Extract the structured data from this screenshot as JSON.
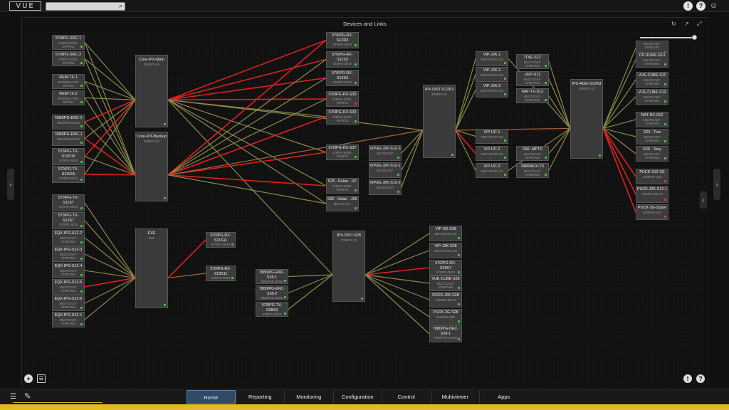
{
  "app": {
    "logo": "VUE"
  },
  "canvas": {
    "title": "Devices and Links"
  },
  "nav": {
    "tabs": [
      {
        "label": "Home",
        "active": true
      },
      {
        "label": "Reporting"
      },
      {
        "label": "Monitoring"
      },
      {
        "label": "Configuration"
      },
      {
        "label": "Control"
      },
      {
        "label": "Multiviewer"
      },
      {
        "label": "Apps"
      }
    ]
  },
  "icons": {
    "search": "search-icon",
    "alert": "!",
    "help": "?",
    "user": "user-icon",
    "refresh": "refresh-icon",
    "popout": "popout-icon",
    "collapse": "collapse-icon",
    "add": "+",
    "grid": "grid-icon",
    "menu": "menu-icon",
    "edit": "pencil-icon"
  },
  "colors": {
    "link_normal": "#8c8a4a",
    "link_alarm": "#e02020",
    "link_warn": "#a8603a",
    "accent": "#e2bb22",
    "tab_active": "#2f4b66"
  },
  "nodes": [
    {
      "id": "src1",
      "name": "570IPG-SRC-1",
      "sub": "570IPG-30/10-SFPIP12",
      "status": "ok"
    },
    {
      "id": "src2",
      "name": "570IPG-SRC-2",
      "sub": "570IPG-30/10-SFPIP12",
      "status": "ok"
    },
    {
      "id": "rtx1",
      "name": "REM-TX-1",
      "sub": "3000REM-TX/8-2MTP12",
      "status": "ok"
    },
    {
      "id": "rtx2",
      "name": "REM-TX-2",
      "sub": "3000REM-TX/8-2MTP12",
      "status": "ok"
    },
    {
      "id": "enc2",
      "name": "7880IPG-ENC-2",
      "sub": "7880IPG8-10GE2",
      "status": "ok"
    },
    {
      "id": "enc1",
      "name": "7880IPG-ENC-1",
      "sub": "7880IPG8-10GE2",
      "status": "ok"
    },
    {
      "id": "txs13515",
      "name": "570IPG-TX-S13S15",
      "sub": "570IPG-30/10",
      "status": "ok"
    },
    {
      "id": "txs11s15",
      "name": "570IPG-TX-S11S15",
      "sub": "570IPG-30/10",
      "status": "ok"
    },
    {
      "id": "txs11s7",
      "name": "570IPG-TX-S11S7",
      "sub": "570IPG-30/10",
      "status": "ok"
    },
    {
      "id": "txs13s7",
      "name": "570IPG-TX-S13S7",
      "sub": "570IPG-30/10",
      "status": "ok"
    },
    {
      "id": "eqx2",
      "name": "EQX-IPG-S12-2",
      "sub": "MULTICAST-STREAMS",
      "status": "ok"
    },
    {
      "id": "eqx3",
      "name": "EQX-IPG-S12-3",
      "sub": "MULTICAST-STREAMS",
      "status": "ok"
    },
    {
      "id": "eqx4",
      "name": "EQX-IPG-S12-4",
      "sub": "MULTICAST-STREAMS",
      "status": "ok"
    },
    {
      "id": "eqx5",
      "name": "EQX-IPG-S12-5",
      "sub": "MULTICAST-STREAMS",
      "status": "ok"
    },
    {
      "id": "eqx6",
      "name": "EQX-IPG-S12-6",
      "sub": "MULTICAST-STREAMS",
      "status": "ok"
    },
    {
      "id": "eqx1",
      "name": "EQX-IPG-S12-1",
      "sub": "MULTICAST-STREAMS",
      "status": "ok"
    },
    {
      "id": "coremain",
      "name": "Core-IPX-Main",
      "sub": "3000IPX-84",
      "status": "ok"
    },
    {
      "id": "coreback",
      "name": "Core-IPX-Backup",
      "sub": "3000IPX-84",
      "status": "ok"
    },
    {
      "id": "exe",
      "name": "EXE",
      "sub": "EXE",
      "status": "ok"
    },
    {
      "id": "rx12r3",
      "name": "570IPG-RX-S12R3",
      "sub": "570IPG-30/10",
      "status": "ok"
    },
    {
      "id": "rx11s3",
      "name": "570IPG-RX-S11S3",
      "sub": "570IPG-30/10",
      "status": "ok"
    },
    {
      "id": "rx13s3",
      "name": "570IPG-RX-S13S3",
      "sub": "570IPG-30/10",
      "status": "ok"
    },
    {
      "id": "rxs30",
      "name": "570IPG-RX-S30",
      "sub": "570IPG-30/10-SFPIP12",
      "status": "alarm"
    },
    {
      "id": "rxs33",
      "name": "570IPG-RX-S33",
      "sub": "570IPG-30/10-SFPIP12",
      "status": "ok"
    },
    {
      "id": "rxs37",
      "name": "570IPG-RX-S37",
      "sub": "570IPG-30/10-SFPIP12",
      "status": "ok"
    },
    {
      "id": "s25uc",
      "name": "S25 - Kelan - UC",
      "sub": "570IPG-30/10-SFPIP12",
      "status": "ok"
    },
    {
      "id": "s25j2k",
      "name": "S25 - Kelan - J2K",
      "sub": "MULTICAST-",
      "status": "ok"
    },
    {
      "id": "rx11s11",
      "name": "570IPG-RX-S11S11",
      "sub": "570IPG-30/10",
      "status": "ok"
    },
    {
      "id": "rx13s11",
      "name": "570IPG-RX-S13S11",
      "sub": "570IPG-30/10",
      "status": "ok"
    },
    {
      "id": "vj3",
      "name": "VIP3G-J2K-S12-3",
      "sub": "MULTICAST-",
      "status": "ok"
    },
    {
      "id": "vj1",
      "name": "VIP3G-J2K-S12-1",
      "sub": "MULTICAST-",
      "status": "ok"
    },
    {
      "id": "vj2",
      "name": "VIP3G-J2K-S12-2",
      "sub": "MULTICAST-",
      "status": "ok"
    },
    {
      "id": "encs281",
      "name": "7880IPG-ENC-S28-1",
      "sub": "7880IPG8-10GE2",
      "status": "ok"
    },
    {
      "id": "encs282",
      "name": "7880IPG-ENC-S28-2",
      "sub": "7880IPG8-10GE2",
      "status": "ok"
    },
    {
      "id": "txs28s3",
      "name": "570IPG-TX-S28S3",
      "sub": "570IPG-30/10",
      "status": "ok"
    },
    {
      "id": "dist12",
      "name": "IPX-DIST-S12R3",
      "sub": "3000IPX-32",
      "status": "ok"
    },
    {
      "id": "dist28",
      "name": "IPX-DIST-S28",
      "sub": "3000IPX-32",
      "status": "ok"
    },
    {
      "id": "vipj2k1",
      "name": "VIP-J2K-1",
      "sub": "3067VIP10G-J2K",
      "status": "ok"
    },
    {
      "id": "vipj2k2",
      "name": "VIP-J2K-2",
      "sub": "3067VIP10G-J2K",
      "status": "ok"
    },
    {
      "id": "vipj2k3",
      "name": "VIP-J2K-3",
      "sub": "3067VIP10G-J2K",
      "status": "ok"
    },
    {
      "id": "vipuc1",
      "name": "VIP-UC-1",
      "sub": "3067VIP10G-3G",
      "status": "ok"
    },
    {
      "id": "vipuc2",
      "name": "VIP-UC-2",
      "sub": "3067VIP10G-3G",
      "status": "ok"
    },
    {
      "id": "vipuc3",
      "name": "VIP-UC-3",
      "sub": "3067VIP10G-3G",
      "status": "ok"
    },
    {
      "id": "itxe",
      "name": "ITXE-S12",
      "sub": "MULTICAST-STREAMS",
      "status": "ok"
    },
    {
      "id": "uep",
      "name": "UEP-S12",
      "sub": "MULTICAST-STREAMS",
      "status": "ok"
    },
    {
      "id": "nattx",
      "name": "NAT-TX-S12",
      "sub": "MULTICAST-STREAMS",
      "status": "ok"
    },
    {
      "id": "s30mpts",
      "name": "S30 -MPTS",
      "sub": "MULTICAST-STREAMS",
      "status": "ok"
    },
    {
      "id": "mux",
      "name": "3480MUX-TX",
      "sub": "MULTICAST-STREAMS",
      "status": "ok"
    },
    {
      "id": "agg",
      "name": "IPX-AGG-S12R3",
      "sub": "3000IPX-32",
      "status": "ok"
    },
    {
      "id": "vip3g28",
      "name": "VIP-3G-S28",
      "sub": "3067VIP10G-3G",
      "status": "ok"
    },
    {
      "id": "vipj2k28",
      "name": "VIP-J2K-S28",
      "sub": "3067VIP10G-J2K",
      "status": "ok"
    },
    {
      "id": "rxs28s7",
      "name": "570IPG-RX-S28S7",
      "sub": "570IPG-30/10",
      "status": "ok"
    },
    {
      "id": "cube28",
      "name": "VUE-CUBE-S28",
      "sub": "MULTICAST-STREAMS",
      "status": "ok"
    },
    {
      "id": "puckj2k28",
      "name": "PUCK-J2K-S28",
      "sub": "2430RX-J2K-IP",
      "status": "ok"
    },
    {
      "id": "puck3g28",
      "name": "PUCK-3G-S28",
      "sub": "2430RX2-10G",
      "status": "ok"
    },
    {
      "id": "dec28",
      "name": "7880IPG-DEC-S28-1",
      "sub": "7880IPG8-10GE2",
      "status": "ok"
    },
    {
      "id": "rtop",
      "name": "",
      "sub": "MULTICAST-STREAMS",
      "status": "ok"
    },
    {
      "id": "cp3100",
      "name": "CP-3100E-S13",
      "sub": "MULTICAST-STREAMS",
      "status": "ok"
    },
    {
      "id": "cube11",
      "name": "VUE-CUBE-S11",
      "sub": "MULTICAST-STREAMS",
      "status": "ok"
    },
    {
      "id": "cube13",
      "name": "VUE-CUBE-S13",
      "sub": "MULTICAST-STREAMS",
      "status": "ok"
    },
    {
      "id": "natrx",
      "name": "NAT-RX-S12",
      "sub": "MULTICAST-STREAMS",
      "status": "ok"
    },
    {
      "id": "s20",
      "name": "S20 - Tom",
      "sub": "MULTICAST-STREAMS",
      "status": "ok"
    },
    {
      "id": "s30tony",
      "name": "S30 - Tony",
      "sub": "MULTICAST-STREAMS",
      "status": "ok"
    },
    {
      "id": "puck3g",
      "name": "PUCK-S12-3G",
      "sub": "2430RX2-10G",
      "status": "alarm"
    },
    {
      "id": "puckj2k1",
      "name": "PUCK-J2K-S12-1",
      "sub": "2430RX-J2K-IP",
      "status": "alarm"
    },
    {
      "id": "puckspare",
      "name": "PUCK-3G-Spare",
      "sub": "2430RX2-10G",
      "status": "alarm"
    }
  ],
  "links": [
    [
      "src1",
      "coremain",
      "n"
    ],
    [
      "src1",
      "coreback",
      "n"
    ],
    [
      "src2",
      "coremain",
      "n"
    ],
    [
      "src2",
      "coreback",
      "n"
    ],
    [
      "rtx1",
      "coremain",
      "n"
    ],
    [
      "rtx1",
      "coreback",
      "n"
    ],
    [
      "rtx2",
      "coremain",
      "n"
    ],
    [
      "rtx2",
      "coreback",
      "n"
    ],
    [
      "enc2",
      "coremain",
      "a"
    ],
    [
      "enc2",
      "coreback",
      "n"
    ],
    [
      "enc1",
      "coremain",
      "n"
    ],
    [
      "enc1",
      "coreback",
      "a"
    ],
    [
      "txs13515",
      "coremain",
      "a"
    ],
    [
      "txs13515",
      "coreback",
      "n"
    ],
    [
      "txs11s15",
      "coremain",
      "n"
    ],
    [
      "txs11s15",
      "coreback",
      "a"
    ],
    [
      "txs11s7",
      "exe",
      "n"
    ],
    [
      "txs13s7",
      "exe",
      "n"
    ],
    [
      "eqx2",
      "exe",
      "n"
    ],
    [
      "eqx3",
      "exe",
      "n"
    ],
    [
      "eqx4",
      "exe",
      "n"
    ],
    [
      "eqx5",
      "exe",
      "a"
    ],
    [
      "eqx6",
      "exe",
      "n"
    ],
    [
      "eqx1",
      "exe",
      "n"
    ],
    [
      "coremain",
      "rx12r3",
      "a"
    ],
    [
      "coremain",
      "rx11s3",
      "a"
    ],
    [
      "coremain",
      "rx13s3",
      "a"
    ],
    [
      "coremain",
      "rxs30",
      "a"
    ],
    [
      "coremain",
      "rxs33",
      "n"
    ],
    [
      "coremain",
      "rxs37",
      "n"
    ],
    [
      "coremain",
      "s25uc",
      "n"
    ],
    [
      "coremain",
      "s25j2k",
      "n"
    ],
    [
      "coremain",
      "dist12",
      "n"
    ],
    [
      "coremain",
      "dist28",
      "n"
    ],
    [
      "coreback",
      "rx12r3",
      "a"
    ],
    [
      "coreback",
      "rx11s3",
      "n"
    ],
    [
      "coreback",
      "rx13s3",
      "n"
    ],
    [
      "coreback",
      "rxs30",
      "n"
    ],
    [
      "coreback",
      "rxs33",
      "a"
    ],
    [
      "coreback",
      "rxs37",
      "a"
    ],
    [
      "coreback",
      "s25uc",
      "a"
    ],
    [
      "coreback",
      "s25j2k",
      "n"
    ],
    [
      "coreback",
      "dist12",
      "w"
    ],
    [
      "exe",
      "rx11s11",
      "a"
    ],
    [
      "exe",
      "rx13s11",
      "w"
    ],
    [
      "vj3",
      "dist12",
      "n"
    ],
    [
      "vj1",
      "dist12",
      "n"
    ],
    [
      "vj2",
      "dist12",
      "n"
    ],
    [
      "dist12",
      "vipj2k1",
      "n"
    ],
    [
      "dist12",
      "vipj2k2",
      "n"
    ],
    [
      "dist12",
      "vipj2k3",
      "n"
    ],
    [
      "dist12",
      "vipuc1",
      "n"
    ],
    [
      "dist12",
      "vipuc2",
      "a"
    ],
    [
      "dist12",
      "vipuc3",
      "n"
    ],
    [
      "dist12",
      "agg",
      "w"
    ],
    [
      "vipj2k1",
      "agg",
      "n"
    ],
    [
      "itxe",
      "agg",
      "n"
    ],
    [
      "uep",
      "agg",
      "n"
    ],
    [
      "nattx",
      "agg",
      "n"
    ],
    [
      "s30mpts",
      "agg",
      "n"
    ],
    [
      "mux",
      "agg",
      "n"
    ],
    [
      "vipuc3",
      "agg",
      "n"
    ],
    [
      "agg",
      "rtop",
      "n"
    ],
    [
      "agg",
      "cp3100",
      "n"
    ],
    [
      "agg",
      "cube11",
      "n"
    ],
    [
      "agg",
      "cube13",
      "n"
    ],
    [
      "agg",
      "natrx",
      "n"
    ],
    [
      "agg",
      "s20",
      "n"
    ],
    [
      "agg",
      "s30tony",
      "n"
    ],
    [
      "agg",
      "puck3g",
      "a"
    ],
    [
      "agg",
      "puckj2k1",
      "a"
    ],
    [
      "agg",
      "puckspare",
      "a"
    ],
    [
      "encs281",
      "dist28",
      "n"
    ],
    [
      "encs282",
      "dist28",
      "n"
    ],
    [
      "txs28s3",
      "dist28",
      "n"
    ],
    [
      "dist28",
      "vip3g28",
      "n"
    ],
    [
      "dist28",
      "vipj2k28",
      "n"
    ],
    [
      "dist28",
      "rxs28s7",
      "a"
    ],
    [
      "dist28",
      "cube28",
      "n"
    ],
    [
      "dist28",
      "puckj2k28",
      "n"
    ],
    [
      "dist28",
      "puck3g28",
      "n"
    ],
    [
      "dist28",
      "dec28",
      "n"
    ]
  ]
}
